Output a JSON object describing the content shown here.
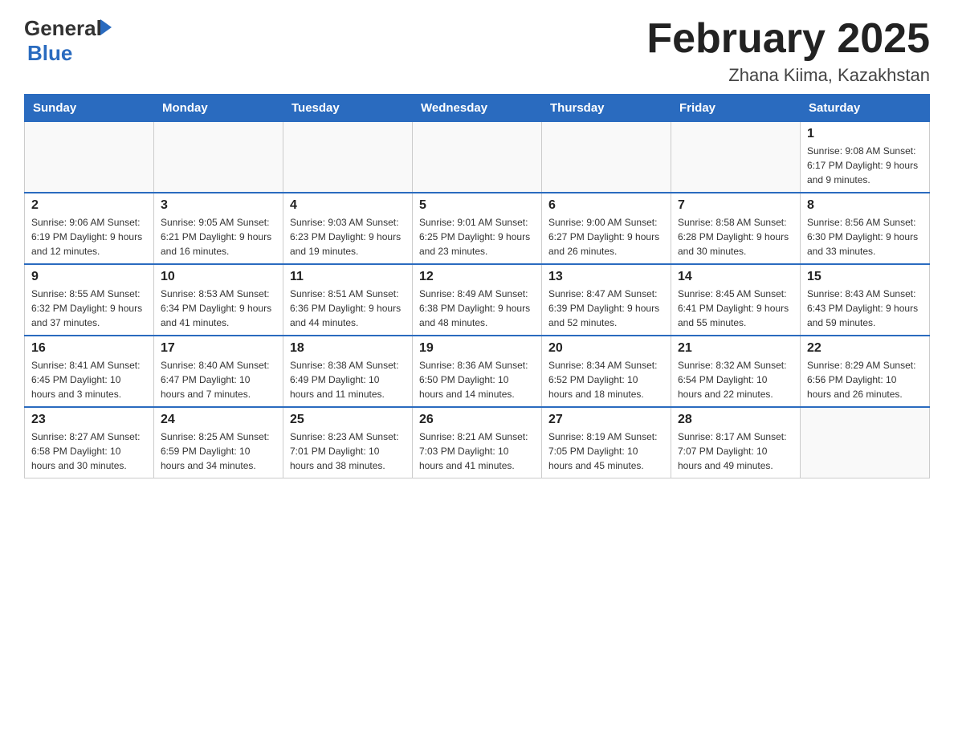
{
  "header": {
    "logo_general": "General",
    "logo_blue": "Blue",
    "month_title": "February 2025",
    "location": "Zhana Kiima, Kazakhstan"
  },
  "days_of_week": [
    "Sunday",
    "Monday",
    "Tuesday",
    "Wednesday",
    "Thursday",
    "Friday",
    "Saturday"
  ],
  "weeks": [
    {
      "days": [
        {
          "number": "",
          "info": ""
        },
        {
          "number": "",
          "info": ""
        },
        {
          "number": "",
          "info": ""
        },
        {
          "number": "",
          "info": ""
        },
        {
          "number": "",
          "info": ""
        },
        {
          "number": "",
          "info": ""
        },
        {
          "number": "1",
          "info": "Sunrise: 9:08 AM\nSunset: 6:17 PM\nDaylight: 9 hours and 9 minutes."
        }
      ]
    },
    {
      "days": [
        {
          "number": "2",
          "info": "Sunrise: 9:06 AM\nSunset: 6:19 PM\nDaylight: 9 hours and 12 minutes."
        },
        {
          "number": "3",
          "info": "Sunrise: 9:05 AM\nSunset: 6:21 PM\nDaylight: 9 hours and 16 minutes."
        },
        {
          "number": "4",
          "info": "Sunrise: 9:03 AM\nSunset: 6:23 PM\nDaylight: 9 hours and 19 minutes."
        },
        {
          "number": "5",
          "info": "Sunrise: 9:01 AM\nSunset: 6:25 PM\nDaylight: 9 hours and 23 minutes."
        },
        {
          "number": "6",
          "info": "Sunrise: 9:00 AM\nSunset: 6:27 PM\nDaylight: 9 hours and 26 minutes."
        },
        {
          "number": "7",
          "info": "Sunrise: 8:58 AM\nSunset: 6:28 PM\nDaylight: 9 hours and 30 minutes."
        },
        {
          "number": "8",
          "info": "Sunrise: 8:56 AM\nSunset: 6:30 PM\nDaylight: 9 hours and 33 minutes."
        }
      ]
    },
    {
      "days": [
        {
          "number": "9",
          "info": "Sunrise: 8:55 AM\nSunset: 6:32 PM\nDaylight: 9 hours and 37 minutes."
        },
        {
          "number": "10",
          "info": "Sunrise: 8:53 AM\nSunset: 6:34 PM\nDaylight: 9 hours and 41 minutes."
        },
        {
          "number": "11",
          "info": "Sunrise: 8:51 AM\nSunset: 6:36 PM\nDaylight: 9 hours and 44 minutes."
        },
        {
          "number": "12",
          "info": "Sunrise: 8:49 AM\nSunset: 6:38 PM\nDaylight: 9 hours and 48 minutes."
        },
        {
          "number": "13",
          "info": "Sunrise: 8:47 AM\nSunset: 6:39 PM\nDaylight: 9 hours and 52 minutes."
        },
        {
          "number": "14",
          "info": "Sunrise: 8:45 AM\nSunset: 6:41 PM\nDaylight: 9 hours and 55 minutes."
        },
        {
          "number": "15",
          "info": "Sunrise: 8:43 AM\nSunset: 6:43 PM\nDaylight: 9 hours and 59 minutes."
        }
      ]
    },
    {
      "days": [
        {
          "number": "16",
          "info": "Sunrise: 8:41 AM\nSunset: 6:45 PM\nDaylight: 10 hours and 3 minutes."
        },
        {
          "number": "17",
          "info": "Sunrise: 8:40 AM\nSunset: 6:47 PM\nDaylight: 10 hours and 7 minutes."
        },
        {
          "number": "18",
          "info": "Sunrise: 8:38 AM\nSunset: 6:49 PM\nDaylight: 10 hours and 11 minutes."
        },
        {
          "number": "19",
          "info": "Sunrise: 8:36 AM\nSunset: 6:50 PM\nDaylight: 10 hours and 14 minutes."
        },
        {
          "number": "20",
          "info": "Sunrise: 8:34 AM\nSunset: 6:52 PM\nDaylight: 10 hours and 18 minutes."
        },
        {
          "number": "21",
          "info": "Sunrise: 8:32 AM\nSunset: 6:54 PM\nDaylight: 10 hours and 22 minutes."
        },
        {
          "number": "22",
          "info": "Sunrise: 8:29 AM\nSunset: 6:56 PM\nDaylight: 10 hours and 26 minutes."
        }
      ]
    },
    {
      "days": [
        {
          "number": "23",
          "info": "Sunrise: 8:27 AM\nSunset: 6:58 PM\nDaylight: 10 hours and 30 minutes."
        },
        {
          "number": "24",
          "info": "Sunrise: 8:25 AM\nSunset: 6:59 PM\nDaylight: 10 hours and 34 minutes."
        },
        {
          "number": "25",
          "info": "Sunrise: 8:23 AM\nSunset: 7:01 PM\nDaylight: 10 hours and 38 minutes."
        },
        {
          "number": "26",
          "info": "Sunrise: 8:21 AM\nSunset: 7:03 PM\nDaylight: 10 hours and 41 minutes."
        },
        {
          "number": "27",
          "info": "Sunrise: 8:19 AM\nSunset: 7:05 PM\nDaylight: 10 hours and 45 minutes."
        },
        {
          "number": "28",
          "info": "Sunrise: 8:17 AM\nSunset: 7:07 PM\nDaylight: 10 hours and 49 minutes."
        },
        {
          "number": "",
          "info": ""
        }
      ]
    }
  ]
}
